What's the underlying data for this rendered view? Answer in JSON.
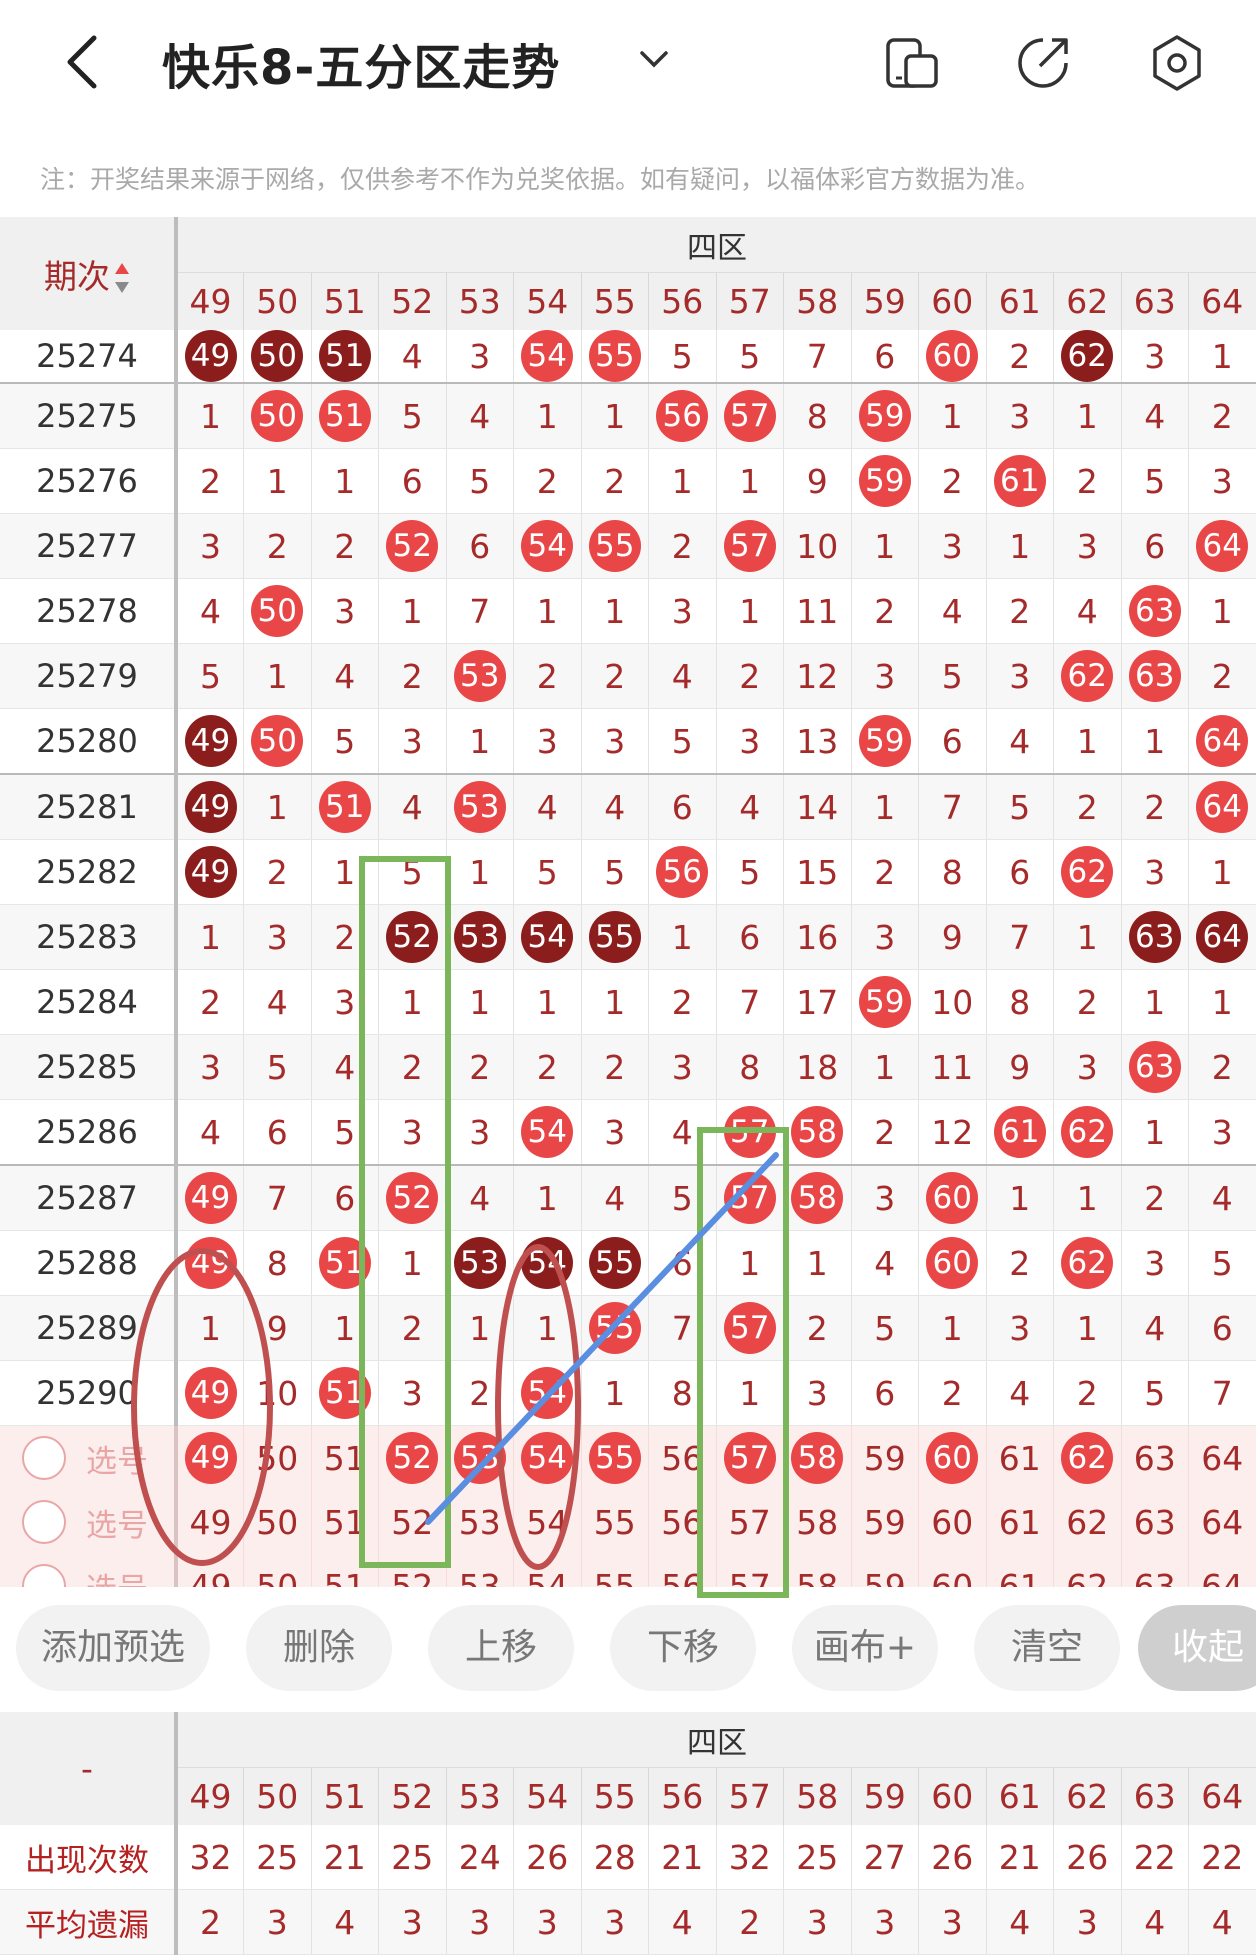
{
  "header": {
    "title": "快乐8-五分区走势",
    "note": "注：开奖结果来源于网络，仅供参考不作为兑奖依据。如有疑问，以福体彩官方数据为准。"
  },
  "table": {
    "period_header": "期次",
    "zone_label": "四区",
    "columns": [
      "49",
      "50",
      "51",
      "52",
      "53",
      "54",
      "55",
      "56",
      "57",
      "58",
      "59",
      "60",
      "61",
      "62",
      "63",
      "64"
    ],
    "rows": [
      {
        "period": "25274",
        "cells": [
          [
            "49",
            "dark"
          ],
          [
            "50",
            "dark"
          ],
          [
            "51",
            "dark"
          ],
          [
            "4",
            ""
          ],
          [
            "3",
            ""
          ],
          [
            "54",
            "red"
          ],
          [
            "55",
            "red"
          ],
          [
            "5",
            ""
          ],
          [
            "5",
            ""
          ],
          [
            "7",
            ""
          ],
          [
            "6",
            ""
          ],
          [
            "60",
            "red"
          ],
          [
            "2",
            ""
          ],
          [
            "62",
            "dark"
          ],
          [
            "3",
            ""
          ],
          [
            "1",
            ""
          ]
        ]
      },
      {
        "period": "25275",
        "cells": [
          [
            "1",
            ""
          ],
          [
            "50",
            "red"
          ],
          [
            "51",
            "red"
          ],
          [
            "5",
            ""
          ],
          [
            "4",
            ""
          ],
          [
            "1",
            ""
          ],
          [
            "1",
            ""
          ],
          [
            "56",
            "red"
          ],
          [
            "57",
            "red"
          ],
          [
            "8",
            ""
          ],
          [
            "59",
            "red"
          ],
          [
            "1",
            ""
          ],
          [
            "3",
            ""
          ],
          [
            "1",
            ""
          ],
          [
            "4",
            ""
          ],
          [
            "2",
            ""
          ]
        ]
      },
      {
        "period": "25276",
        "cells": [
          [
            "2",
            ""
          ],
          [
            "1",
            ""
          ],
          [
            "1",
            ""
          ],
          [
            "6",
            ""
          ],
          [
            "5",
            ""
          ],
          [
            "2",
            ""
          ],
          [
            "2",
            ""
          ],
          [
            "1",
            ""
          ],
          [
            "1",
            ""
          ],
          [
            "9",
            ""
          ],
          [
            "59",
            "red"
          ],
          [
            "2",
            ""
          ],
          [
            "61",
            "red"
          ],
          [
            "2",
            ""
          ],
          [
            "5",
            ""
          ],
          [
            "3",
            ""
          ]
        ]
      },
      {
        "period": "25277",
        "cells": [
          [
            "3",
            ""
          ],
          [
            "2",
            ""
          ],
          [
            "2",
            ""
          ],
          [
            "52",
            "red"
          ],
          [
            "6",
            ""
          ],
          [
            "54",
            "red"
          ],
          [
            "55",
            "red"
          ],
          [
            "2",
            ""
          ],
          [
            "57",
            "red"
          ],
          [
            "10",
            ""
          ],
          [
            "1",
            ""
          ],
          [
            "3",
            ""
          ],
          [
            "1",
            ""
          ],
          [
            "3",
            ""
          ],
          [
            "6",
            ""
          ],
          [
            "64",
            "red"
          ]
        ]
      },
      {
        "period": "25278",
        "cells": [
          [
            "4",
            ""
          ],
          [
            "50",
            "red"
          ],
          [
            "3",
            ""
          ],
          [
            "1",
            ""
          ],
          [
            "7",
            ""
          ],
          [
            "1",
            ""
          ],
          [
            "1",
            ""
          ],
          [
            "3",
            ""
          ],
          [
            "1",
            ""
          ],
          [
            "11",
            ""
          ],
          [
            "2",
            ""
          ],
          [
            "4",
            ""
          ],
          [
            "2",
            ""
          ],
          [
            "4",
            ""
          ],
          [
            "63",
            "red"
          ],
          [
            "1",
            ""
          ]
        ]
      },
      {
        "period": "25279",
        "cells": [
          [
            "5",
            ""
          ],
          [
            "1",
            ""
          ],
          [
            "4",
            ""
          ],
          [
            "2",
            ""
          ],
          [
            "53",
            "red"
          ],
          [
            "2",
            ""
          ],
          [
            "2",
            ""
          ],
          [
            "4",
            ""
          ],
          [
            "2",
            ""
          ],
          [
            "12",
            ""
          ],
          [
            "3",
            ""
          ],
          [
            "5",
            ""
          ],
          [
            "3",
            ""
          ],
          [
            "62",
            "red"
          ],
          [
            "63",
            "red"
          ],
          [
            "2",
            ""
          ]
        ]
      },
      {
        "period": "25280",
        "cells": [
          [
            "49",
            "dark"
          ],
          [
            "50",
            "red"
          ],
          [
            "5",
            ""
          ],
          [
            "3",
            ""
          ],
          [
            "1",
            ""
          ],
          [
            "3",
            ""
          ],
          [
            "3",
            ""
          ],
          [
            "5",
            ""
          ],
          [
            "3",
            ""
          ],
          [
            "13",
            ""
          ],
          [
            "59",
            "red"
          ],
          [
            "6",
            ""
          ],
          [
            "4",
            ""
          ],
          [
            "1",
            ""
          ],
          [
            "1",
            ""
          ],
          [
            "64",
            "red"
          ]
        ]
      },
      {
        "period": "25281",
        "cells": [
          [
            "49",
            "dark"
          ],
          [
            "1",
            ""
          ],
          [
            "51",
            "red"
          ],
          [
            "4",
            ""
          ],
          [
            "53",
            "red"
          ],
          [
            "4",
            ""
          ],
          [
            "4",
            ""
          ],
          [
            "6",
            ""
          ],
          [
            "4",
            ""
          ],
          [
            "14",
            ""
          ],
          [
            "1",
            ""
          ],
          [
            "7",
            ""
          ],
          [
            "5",
            ""
          ],
          [
            "2",
            ""
          ],
          [
            "2",
            ""
          ],
          [
            "64",
            "red"
          ]
        ]
      },
      {
        "period": "25282",
        "cells": [
          [
            "49",
            "dark"
          ],
          [
            "2",
            ""
          ],
          [
            "1",
            ""
          ],
          [
            "5",
            ""
          ],
          [
            "1",
            ""
          ],
          [
            "5",
            ""
          ],
          [
            "5",
            ""
          ],
          [
            "56",
            "red"
          ],
          [
            "5",
            ""
          ],
          [
            "15",
            ""
          ],
          [
            "2",
            ""
          ],
          [
            "8",
            ""
          ],
          [
            "6",
            ""
          ],
          [
            "62",
            "red"
          ],
          [
            "3",
            ""
          ],
          [
            "1",
            ""
          ]
        ]
      },
      {
        "period": "25283",
        "cells": [
          [
            "1",
            ""
          ],
          [
            "3",
            ""
          ],
          [
            "2",
            ""
          ],
          [
            "52",
            "dark"
          ],
          [
            "53",
            "dark"
          ],
          [
            "54",
            "dark"
          ],
          [
            "55",
            "dark"
          ],
          [
            "1",
            ""
          ],
          [
            "6",
            ""
          ],
          [
            "16",
            ""
          ],
          [
            "3",
            ""
          ],
          [
            "9",
            ""
          ],
          [
            "7",
            ""
          ],
          [
            "1",
            ""
          ],
          [
            "63",
            "dark"
          ],
          [
            "64",
            "dark"
          ]
        ]
      },
      {
        "period": "25284",
        "cells": [
          [
            "2",
            ""
          ],
          [
            "4",
            ""
          ],
          [
            "3",
            ""
          ],
          [
            "1",
            ""
          ],
          [
            "1",
            ""
          ],
          [
            "1",
            ""
          ],
          [
            "1",
            ""
          ],
          [
            "2",
            ""
          ],
          [
            "7",
            ""
          ],
          [
            "17",
            ""
          ],
          [
            "59",
            "red"
          ],
          [
            "10",
            ""
          ],
          [
            "8",
            ""
          ],
          [
            "2",
            ""
          ],
          [
            "1",
            ""
          ],
          [
            "1",
            ""
          ]
        ]
      },
      {
        "period": "25285",
        "cells": [
          [
            "3",
            ""
          ],
          [
            "5",
            ""
          ],
          [
            "4",
            ""
          ],
          [
            "2",
            ""
          ],
          [
            "2",
            ""
          ],
          [
            "2",
            ""
          ],
          [
            "2",
            ""
          ],
          [
            "3",
            ""
          ],
          [
            "8",
            ""
          ],
          [
            "18",
            ""
          ],
          [
            "1",
            ""
          ],
          [
            "11",
            ""
          ],
          [
            "9",
            ""
          ],
          [
            "3",
            ""
          ],
          [
            "63",
            "red"
          ],
          [
            "2",
            ""
          ]
        ]
      },
      {
        "period": "25286",
        "cells": [
          [
            "4",
            ""
          ],
          [
            "6",
            ""
          ],
          [
            "5",
            ""
          ],
          [
            "3",
            ""
          ],
          [
            "3",
            ""
          ],
          [
            "54",
            "red"
          ],
          [
            "3",
            ""
          ],
          [
            "4",
            ""
          ],
          [
            "57",
            "red"
          ],
          [
            "58",
            "red"
          ],
          [
            "2",
            ""
          ],
          [
            "12",
            ""
          ],
          [
            "61",
            "red"
          ],
          [
            "62",
            "red"
          ],
          [
            "1",
            ""
          ],
          [
            "3",
            ""
          ]
        ]
      },
      {
        "period": "25287",
        "cells": [
          [
            "49",
            "red"
          ],
          [
            "7",
            ""
          ],
          [
            "6",
            ""
          ],
          [
            "52",
            "red"
          ],
          [
            "4",
            ""
          ],
          [
            "1",
            ""
          ],
          [
            "4",
            ""
          ],
          [
            "5",
            ""
          ],
          [
            "57",
            "red"
          ],
          [
            "58",
            "red"
          ],
          [
            "3",
            ""
          ],
          [
            "60",
            "red"
          ],
          [
            "1",
            ""
          ],
          [
            "1",
            ""
          ],
          [
            "2",
            ""
          ],
          [
            "4",
            ""
          ]
        ]
      },
      {
        "period": "25288",
        "cells": [
          [
            "49",
            "red"
          ],
          [
            "8",
            ""
          ],
          [
            "51",
            "red"
          ],
          [
            "1",
            ""
          ],
          [
            "53",
            "dark"
          ],
          [
            "54",
            "dark"
          ],
          [
            "55",
            "dark"
          ],
          [
            "6",
            ""
          ],
          [
            "1",
            ""
          ],
          [
            "1",
            ""
          ],
          [
            "4",
            ""
          ],
          [
            "60",
            "red"
          ],
          [
            "2",
            ""
          ],
          [
            "62",
            "red"
          ],
          [
            "3",
            ""
          ],
          [
            "5",
            ""
          ]
        ]
      },
      {
        "period": "25289",
        "cells": [
          [
            "1",
            ""
          ],
          [
            "9",
            ""
          ],
          [
            "1",
            ""
          ],
          [
            "2",
            ""
          ],
          [
            "1",
            ""
          ],
          [
            "1",
            ""
          ],
          [
            "55",
            "red"
          ],
          [
            "7",
            ""
          ],
          [
            "57",
            "red"
          ],
          [
            "2",
            ""
          ],
          [
            "5",
            ""
          ],
          [
            "1",
            ""
          ],
          [
            "3",
            ""
          ],
          [
            "1",
            ""
          ],
          [
            "4",
            ""
          ],
          [
            "6",
            ""
          ]
        ]
      },
      {
        "period": "25290",
        "cells": [
          [
            "49",
            "red"
          ],
          [
            "10",
            ""
          ],
          [
            "51",
            "red"
          ],
          [
            "3",
            ""
          ],
          [
            "2",
            ""
          ],
          [
            "54",
            "red"
          ],
          [
            "1",
            ""
          ],
          [
            "8",
            ""
          ],
          [
            "1",
            ""
          ],
          [
            "3",
            ""
          ],
          [
            "6",
            ""
          ],
          [
            "2",
            ""
          ],
          [
            "4",
            ""
          ],
          [
            "2",
            ""
          ],
          [
            "5",
            ""
          ],
          [
            "7",
            ""
          ]
        ]
      }
    ],
    "select_label": "选号",
    "select_rows": [
      [
        "49",
        "52",
        "53",
        "54",
        "55",
        "57",
        "58",
        "60",
        "62"
      ],
      [],
      []
    ]
  },
  "buttons": {
    "add": "添加预选",
    "delete": "删除",
    "up": "上移",
    "down": "下移",
    "canvas": "画布+",
    "clear": "清空",
    "collapse": "收起"
  },
  "stats": {
    "corner": "-",
    "zone_label": "四区",
    "columns": [
      "49",
      "50",
      "51",
      "52",
      "53",
      "54",
      "55",
      "56",
      "57",
      "58",
      "59",
      "60",
      "61",
      "62",
      "63",
      "64"
    ],
    "rows": [
      {
        "label": "出现次数",
        "values": [
          "32",
          "25",
          "21",
          "25",
          "24",
          "26",
          "28",
          "21",
          "32",
          "25",
          "27",
          "26",
          "21",
          "26",
          "22",
          "22"
        ]
      },
      {
        "label": "平均遗漏",
        "values": [
          "2",
          "3",
          "4",
          "3",
          "3",
          "3",
          "3",
          "4",
          "2",
          "3",
          "3",
          "3",
          "4",
          "3",
          "4",
          "4"
        ]
      }
    ]
  },
  "colors": {
    "ball_red": "#e94747",
    "ball_dark": "#8c1d1d",
    "value_text": "#a52a2a",
    "annotation_green": "#7cb65a",
    "annotation_red": "#c05050",
    "annotation_blue": "#5a8ee0"
  }
}
